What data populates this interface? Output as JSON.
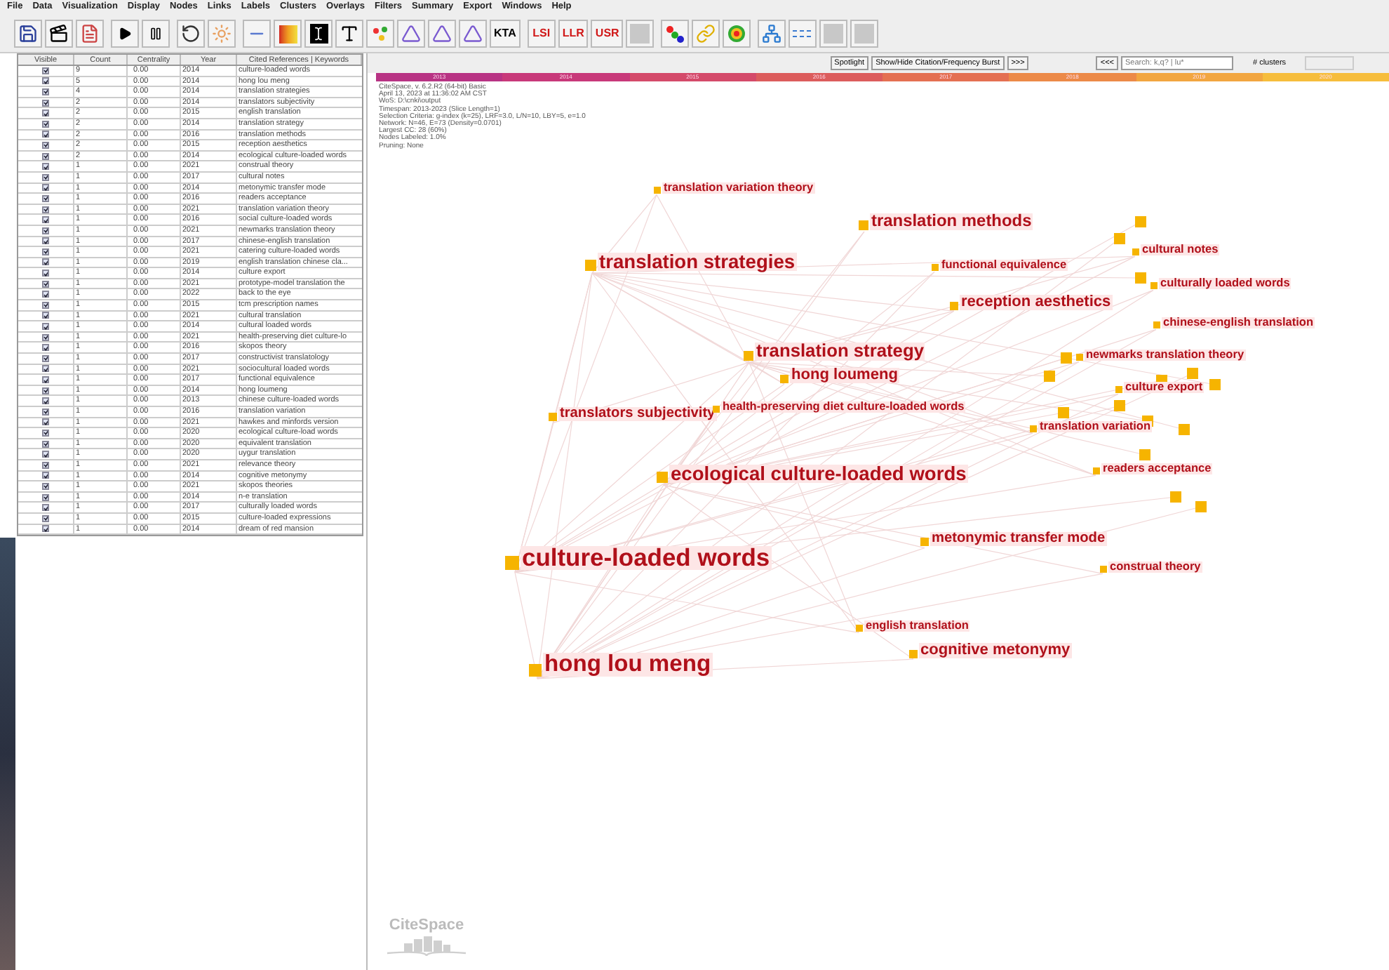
{
  "menu": [
    "File",
    "Data",
    "Visualization",
    "Display",
    "Nodes",
    "Links",
    "Labels",
    "Clusters",
    "Overlays",
    "Filters",
    "Summary",
    "Export",
    "Windows",
    "Help"
  ],
  "toolbar": [
    [
      {
        "kind": "save"
      },
      {
        "kind": "clapper"
      },
      {
        "kind": "pdf"
      }
    ],
    [
      {
        "kind": "play"
      },
      {
        "kind": "pause"
      }
    ],
    [
      {
        "kind": "refresh"
      },
      {
        "kind": "burst"
      }
    ],
    [
      {
        "kind": "line"
      },
      {
        "kind": "heatmap"
      },
      {
        "kind": "cursor"
      },
      {
        "kind": "type"
      },
      {
        "kind": "scatter"
      },
      {
        "kind": "triangle"
      },
      {
        "kind": "triangle"
      },
      {
        "kind": "triangle"
      },
      {
        "kind": "text",
        "label": "KTA"
      }
    ],
    [
      {
        "kind": "label-text",
        "label": "LSI"
      },
      {
        "kind": "label-text",
        "label": "LLR"
      },
      {
        "kind": "label-text",
        "label": "USR"
      },
      {
        "kind": "blank"
      }
    ],
    [
      {
        "kind": "dots"
      },
      {
        "kind": "chain"
      },
      {
        "kind": "target"
      }
    ],
    [
      {
        "kind": "network"
      },
      {
        "kind": "dashed"
      },
      {
        "kind": "blank"
      },
      {
        "kind": "blank"
      }
    ]
  ],
  "table": {
    "columns": [
      "Visible",
      "Count",
      "Centrality",
      "Year",
      "Cited References | Keywords"
    ],
    "rows": [
      {
        "visible": true,
        "count": "9",
        "centrality": "0.00",
        "year": "2014",
        "keyword": "culture-loaded words"
      },
      {
        "visible": true,
        "count": "5",
        "centrality": "0.00",
        "year": "2014",
        "keyword": "hong lou meng"
      },
      {
        "visible": true,
        "count": "4",
        "centrality": "0.00",
        "year": "2014",
        "keyword": "translation strategies"
      },
      {
        "visible": true,
        "count": "2",
        "centrality": "0.00",
        "year": "2014",
        "keyword": "translators subjectivity"
      },
      {
        "visible": true,
        "count": "2",
        "centrality": "0.00",
        "year": "2015",
        "keyword": "english translation"
      },
      {
        "visible": true,
        "count": "2",
        "centrality": "0.00",
        "year": "2014",
        "keyword": "translation strategy"
      },
      {
        "visible": true,
        "count": "2",
        "centrality": "0.00",
        "year": "2016",
        "keyword": "translation methods"
      },
      {
        "visible": true,
        "count": "2",
        "centrality": "0.00",
        "year": "2015",
        "keyword": "reception aesthetics"
      },
      {
        "visible": true,
        "count": "2",
        "centrality": "0.00",
        "year": "2014",
        "keyword": "ecological culture-loaded words"
      },
      {
        "visible": true,
        "count": "1",
        "centrality": "0.00",
        "year": "2021",
        "keyword": "construal theory"
      },
      {
        "visible": true,
        "count": "1",
        "centrality": "0.00",
        "year": "2017",
        "keyword": "cultural notes"
      },
      {
        "visible": true,
        "count": "1",
        "centrality": "0.00",
        "year": "2014",
        "keyword": "metonymic transfer mode"
      },
      {
        "visible": true,
        "count": "1",
        "centrality": "0.00",
        "year": "2016",
        "keyword": "readers acceptance"
      },
      {
        "visible": true,
        "count": "1",
        "centrality": "0.00",
        "year": "2021",
        "keyword": "translation variation theory"
      },
      {
        "visible": true,
        "count": "1",
        "centrality": "0.00",
        "year": "2016",
        "keyword": "social culture-loaded words"
      },
      {
        "visible": true,
        "count": "1",
        "centrality": "0.00",
        "year": "2021",
        "keyword": "newmarks translation theory"
      },
      {
        "visible": true,
        "count": "1",
        "centrality": "0.00",
        "year": "2017",
        "keyword": "chinese-english translation"
      },
      {
        "visible": true,
        "count": "1",
        "centrality": "0.00",
        "year": "2021",
        "keyword": "catering culture-loaded words"
      },
      {
        "visible": true,
        "count": "1",
        "centrality": "0.00",
        "year": "2019",
        "keyword": "english translation chinese cla..."
      },
      {
        "visible": true,
        "count": "1",
        "centrality": "0.00",
        "year": "2014",
        "keyword": "culture export"
      },
      {
        "visible": true,
        "count": "1",
        "centrality": "0.00",
        "year": "2021",
        "keyword": "prototype-model translation the"
      },
      {
        "visible": true,
        "count": "1",
        "centrality": "0.00",
        "year": "2022",
        "keyword": "back to the eye"
      },
      {
        "visible": true,
        "count": "1",
        "centrality": "0.00",
        "year": "2015",
        "keyword": "tcm prescription names"
      },
      {
        "visible": true,
        "count": "1",
        "centrality": "0.00",
        "year": "2021",
        "keyword": "cultural translation"
      },
      {
        "visible": true,
        "count": "1",
        "centrality": "0.00",
        "year": "2014",
        "keyword": "cultural loaded words"
      },
      {
        "visible": true,
        "count": "1",
        "centrality": "0.00",
        "year": "2021",
        "keyword": "health-preserving diet culture-lo"
      },
      {
        "visible": true,
        "count": "1",
        "centrality": "0.00",
        "year": "2016",
        "keyword": "skopos theory"
      },
      {
        "visible": true,
        "count": "1",
        "centrality": "0.00",
        "year": "2017",
        "keyword": "constructivist translatology"
      },
      {
        "visible": true,
        "count": "1",
        "centrality": "0.00",
        "year": "2021",
        "keyword": "sociocultural loaded words"
      },
      {
        "visible": true,
        "count": "1",
        "centrality": "0.00",
        "year": "2017",
        "keyword": "functional equivalence"
      },
      {
        "visible": true,
        "count": "1",
        "centrality": "0.00",
        "year": "2014",
        "keyword": "hong loumeng"
      },
      {
        "visible": true,
        "count": "1",
        "centrality": "0.00",
        "year": "2013",
        "keyword": "chinese culture-loaded words"
      },
      {
        "visible": true,
        "count": "1",
        "centrality": "0.00",
        "year": "2016",
        "keyword": "translation variation"
      },
      {
        "visible": true,
        "count": "1",
        "centrality": "0.00",
        "year": "2021",
        "keyword": "hawkes and minfords version"
      },
      {
        "visible": true,
        "count": "1",
        "centrality": "0.00",
        "year": "2020",
        "keyword": "ecological culture-load words"
      },
      {
        "visible": true,
        "count": "1",
        "centrality": "0.00",
        "year": "2020",
        "keyword": "equivalent translation"
      },
      {
        "visible": true,
        "count": "1",
        "centrality": "0.00",
        "year": "2020",
        "keyword": "uygur translation"
      },
      {
        "visible": true,
        "count": "1",
        "centrality": "0.00",
        "year": "2021",
        "keyword": "relevance theory"
      },
      {
        "visible": true,
        "count": "1",
        "centrality": "0.00",
        "year": "2014",
        "keyword": "cognitive metonymy"
      },
      {
        "visible": true,
        "count": "1",
        "centrality": "0.00",
        "year": "2021",
        "keyword": "skopos theories"
      },
      {
        "visible": true,
        "count": "1",
        "centrality": "0.00",
        "year": "2014",
        "keyword": "n-e translation"
      },
      {
        "visible": true,
        "count": "1",
        "centrality": "0.00",
        "year": "2017",
        "keyword": "culturally loaded words"
      },
      {
        "visible": true,
        "count": "1",
        "centrality": "0.00",
        "year": "2015",
        "keyword": "culture-loaded expressions"
      },
      {
        "visible": true,
        "count": "1",
        "centrality": "0.00",
        "year": "2014",
        "keyword": "dream of red mansion"
      }
    ]
  },
  "controls": {
    "spotlight": "Spotlight",
    "burst": "Show/Hide Citation/Frequency Burst",
    "next": ">>>",
    "prev": "<<<",
    "search": "Search: k,q? | lu*",
    "clusters_label": "# clusters"
  },
  "timeline": [
    {
      "year": "2013",
      "color": "#b83384"
    },
    {
      "year": "2014",
      "color": "#c8397a"
    },
    {
      "year": "2015",
      "color": "#d44a6a"
    },
    {
      "year": "2016",
      "color": "#dc5c5c"
    },
    {
      "year": "2017",
      "color": "#e47052"
    },
    {
      "year": "2018",
      "color": "#ec8a48"
    },
    {
      "year": "2019",
      "color": "#f2a640"
    },
    {
      "year": "2020",
      "color": "#f6bd3c"
    }
  ],
  "info_lines": [
    "CiteSpace, v. 6.2.R2 (64-bit) Basic",
    "April 13, 2023 at 11:36:02 AM CST",
    "WoS: D:\\cnki\\output",
    "Timespan: 2013-2023 (Slice Length=1)",
    "Selection Criteria: g-index (k=25), LRF=3.0, L/N=10, LBY=5, e=1.0",
    "Network: N=46, E=73 (Density=0.0701)",
    "Largest CC: 28 (60%)",
    "Nodes Labeled: 1.0%",
    "Pruning: None"
  ],
  "nodes": [
    "translation variation theory",
    "translation methods",
    "translation strategies",
    "functional equivalence",
    "cultural notes",
    "culturally loaded words",
    "reception aesthetics",
    "chinese-english translation",
    "translation strategy",
    "newmarks translation theory",
    "hong loumeng",
    "culture export",
    "translators subjectivity",
    "health-preserving diet culture-loaded words",
    "translation variation",
    "ecological culture-loaded words",
    "readers acceptance",
    "metonymic transfer mode",
    "culture-loaded words",
    "construal theory",
    "english translation",
    "cognitive metonymy",
    "hong lou meng"
  ],
  "logo": "CiteSpace"
}
